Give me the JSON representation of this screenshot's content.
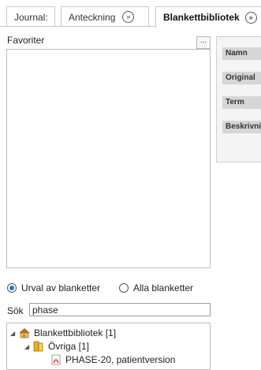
{
  "tabs": [
    {
      "label": "Journal:",
      "active": false
    },
    {
      "label": "Anteckning",
      "active": false
    },
    {
      "label": "Blankettbibliotek",
      "active": true
    }
  ],
  "tab_expand_glyph": "»",
  "favorites": {
    "label": "Favoriter",
    "more_button": "..."
  },
  "filter": {
    "options": [
      {
        "label": "Urval av blanketter",
        "selected": true
      },
      {
        "label": "Alla blanketter",
        "selected": false
      }
    ]
  },
  "search": {
    "label": "Sök",
    "value": "phase"
  },
  "tree": [
    {
      "label": "Blankettbibliotek [1]",
      "icon": "library-icon",
      "level": 0,
      "expanded": true
    },
    {
      "label": "Övriga [1]",
      "icon": "folder-icon",
      "level": 1,
      "expanded": true
    },
    {
      "label": "PHASE-20, patientversion",
      "icon": "pdf-icon",
      "level": 2
    }
  ],
  "properties": [
    {
      "label": "Namn"
    },
    {
      "label": "Original"
    },
    {
      "label": "Term"
    },
    {
      "label": "Beskrivning"
    }
  ],
  "colors": {
    "radio_selected": "#2a6fd3",
    "folder": "#e3b21f",
    "pdf": "#d9362b"
  }
}
